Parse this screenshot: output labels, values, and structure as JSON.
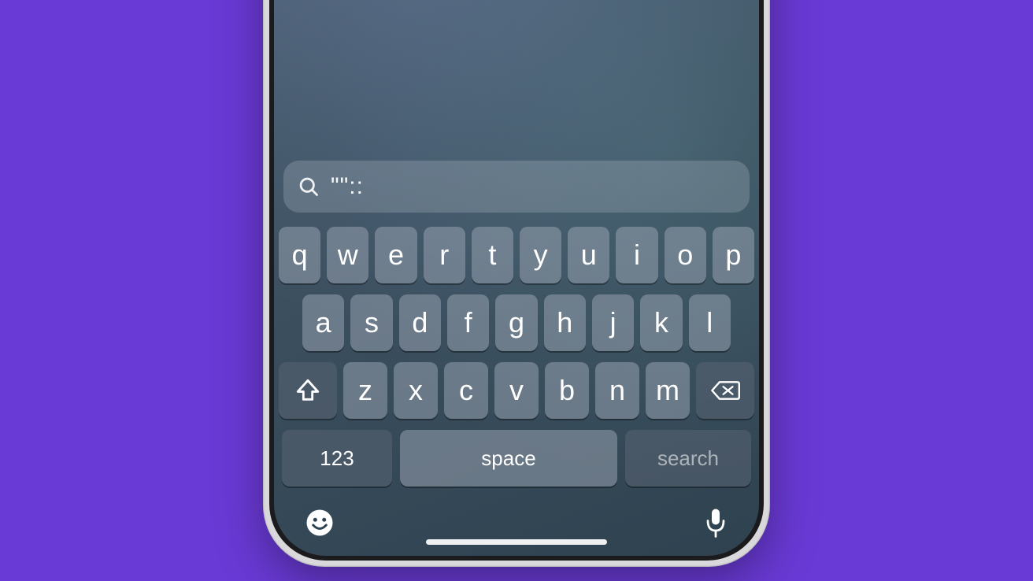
{
  "search": {
    "value": "\"\"::"
  },
  "keyboard": {
    "row1": [
      "q",
      "w",
      "e",
      "r",
      "t",
      "y",
      "u",
      "i",
      "o",
      "p"
    ],
    "row2": [
      "a",
      "s",
      "d",
      "f",
      "g",
      "h",
      "j",
      "k",
      "l"
    ],
    "row3": [
      "z",
      "x",
      "c",
      "v",
      "b",
      "n",
      "m"
    ],
    "numeric_label": "123",
    "space_label": "space",
    "action_label": "search"
  }
}
